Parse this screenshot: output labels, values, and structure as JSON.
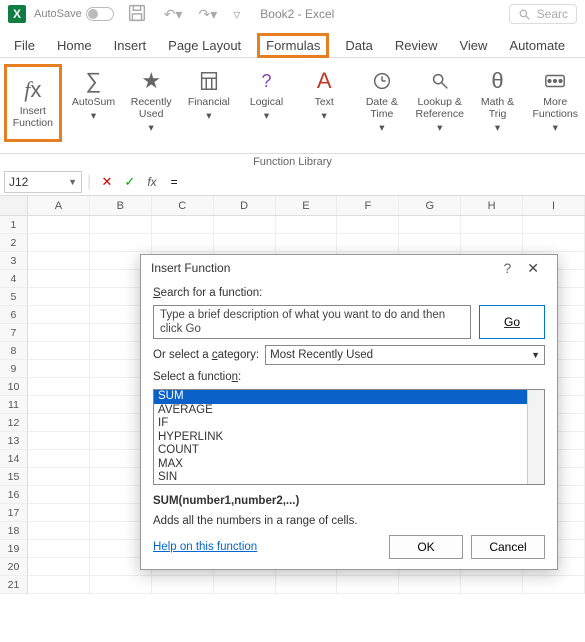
{
  "titlebar": {
    "autosave_label": "AutoSave",
    "book_title": "Book2 - Excel",
    "search_placeholder": "Searc"
  },
  "tabs": {
    "file": "File",
    "home": "Home",
    "insert": "Insert",
    "page_layout": "Page Layout",
    "formulas": "Formulas",
    "data": "Data",
    "review": "Review",
    "view": "View",
    "automate": "Automate"
  },
  "ribbon": {
    "insert_function": "Insert Function",
    "autosum": "AutoSum",
    "recently_used": "Recently Used",
    "financial": "Financial",
    "logical": "Logical",
    "text": "Text",
    "date_time": "Date & Time",
    "lookup_ref": "Lookup & Reference",
    "math_trig": "Math & Trig",
    "more_functions": "More Functions",
    "group_label": "Function Library"
  },
  "formula_bar": {
    "name_box": "J12",
    "formula": "="
  },
  "grid": {
    "columns": [
      "A",
      "B",
      "C",
      "D",
      "E",
      "F",
      "G",
      "H",
      "I"
    ],
    "rows": [
      "1",
      "2",
      "3",
      "4",
      "5",
      "6",
      "7",
      "8",
      "9",
      "10",
      "11",
      "12",
      "13",
      "14",
      "15",
      "16",
      "17",
      "18",
      "19",
      "20",
      "21"
    ]
  },
  "dialog": {
    "title": "Insert Function",
    "search_label": "Search for a function:",
    "search_text": "Type a brief description of what you want to do and then click Go",
    "go": "Go",
    "category_label": "Or select a category:",
    "category_value": "Most Recently Used",
    "select_label": "Select a function:",
    "functions": [
      "SUM",
      "AVERAGE",
      "IF",
      "HYPERLINK",
      "COUNT",
      "MAX",
      "SIN"
    ],
    "signature": "SUM(number1,number2,...)",
    "description": "Adds all the numbers in a range of cells.",
    "help_link": "Help on this function",
    "ok": "OK",
    "cancel": "Cancel"
  }
}
